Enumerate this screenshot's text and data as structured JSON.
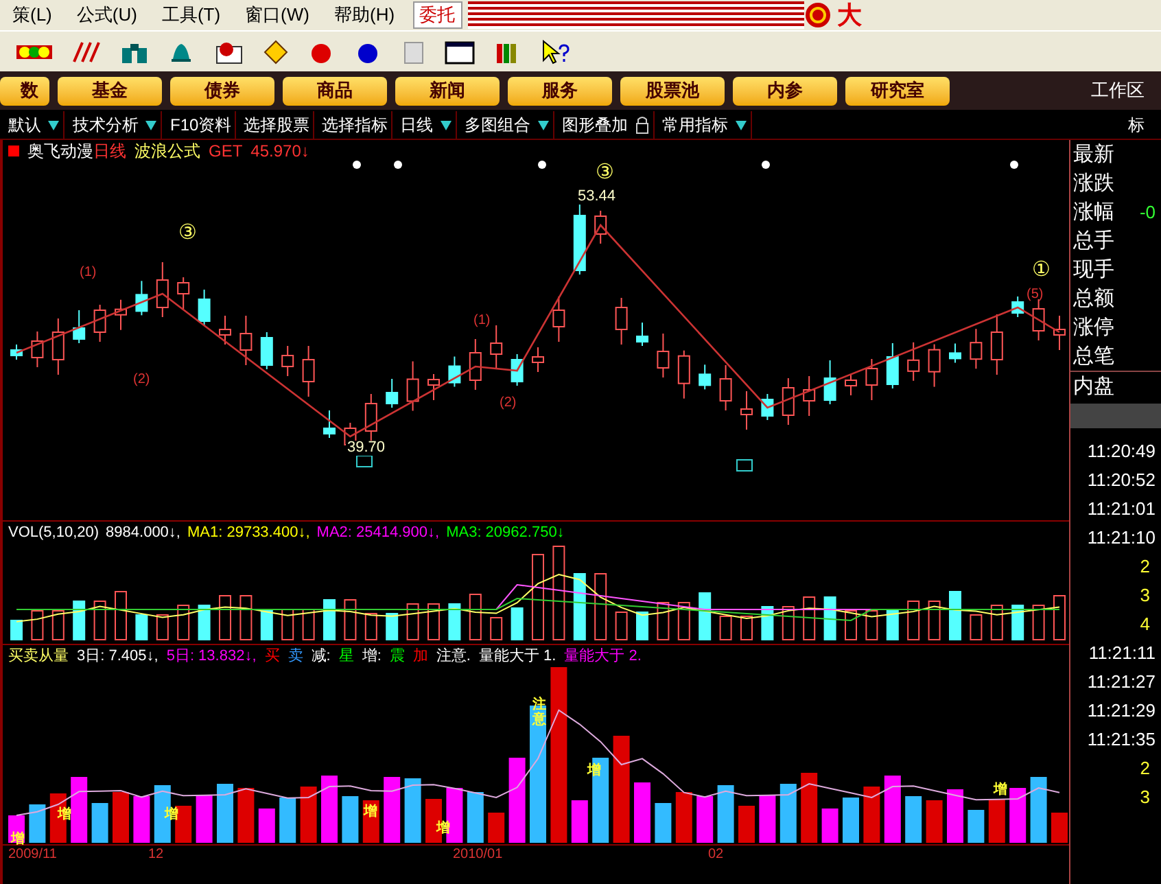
{
  "menu": {
    "items": [
      "策(L)",
      "公式(U)",
      "工具(T)",
      "窗口(W)",
      "帮助(H)"
    ],
    "trade_button": "委托",
    "corner_text": "大"
  },
  "nav_buttons": [
    "数",
    "基金",
    "债券",
    "商品",
    "新闻",
    "服务",
    "股票池",
    "内参",
    "研究室"
  ],
  "workspace_label": "工作区",
  "tabs": [
    {
      "label": "默认",
      "has_menu": true,
      "lock": false
    },
    {
      "label": "技术分析",
      "has_menu": true,
      "lock": false
    },
    {
      "label": "F10资料",
      "has_menu": false,
      "lock": false
    },
    {
      "label": "选择股票",
      "has_menu": false,
      "lock": false
    },
    {
      "label": "选择指标",
      "has_menu": false,
      "lock": false
    },
    {
      "label": "日线",
      "has_menu": true,
      "lock": false
    },
    {
      "label": "多图组合",
      "has_menu": true,
      "lock": false
    },
    {
      "label": "图形叠加",
      "has_menu": false,
      "lock": true
    },
    {
      "label": "常用指标",
      "has_menu": true,
      "lock": false
    }
  ],
  "tab_right": "标",
  "price_chart": {
    "stock": "奥飞动漫",
    "period": "日线",
    "formula": "波浪公式",
    "tag": "GET",
    "value": "45.970↓",
    "wave_labels": [
      "③",
      "③",
      "①"
    ],
    "price_labels": [
      "53.44",
      "39.70"
    ],
    "point_labels": [
      "(1)",
      "(2)",
      "(1)",
      "(2)",
      "(5)"
    ]
  },
  "volume_chart": {
    "name": "VOL(5,10,20)",
    "value": "8984.000↓,",
    "ma": [
      {
        "text": "MA1: 29733.400↓,",
        "color": "#ffff00"
      },
      {
        "text": "MA2: 25414.900↓,",
        "color": "#ff00ff"
      },
      {
        "text": "MA3: 20962.750↓",
        "color": "#00ff00"
      }
    ]
  },
  "indicator": {
    "name": "买卖从量",
    "legend": [
      {
        "text": "3日: 7.405↓,",
        "color": "#ffffff"
      },
      {
        "text": "5日: 13.832↓,",
        "color": "#ff00ff"
      },
      {
        "text": "买",
        "color": "#ff0000"
      },
      {
        "text": "卖",
        "color": "#3399ff"
      },
      {
        "text": "减:",
        "color": "#ffffff"
      },
      {
        "text": "星",
        "color": "#00ff00"
      },
      {
        "text": "增:",
        "color": "#ffffff"
      },
      {
        "text": "震",
        "color": "#00ff00"
      },
      {
        "text": "加",
        "color": "#ff0000"
      },
      {
        "text": "注意.",
        "color": "#ffffff"
      },
      {
        "text": "量能大于 1.",
        "color": "#ffffff"
      },
      {
        "text": "量能大于 2.",
        "color": "#ff00ff"
      }
    ],
    "bar_labels": [
      "增",
      "增",
      "增",
      "增",
      "增",
      "注意",
      "增",
      "增"
    ]
  },
  "date_axis": [
    "2009/11",
    "12",
    "2010/01",
    "02"
  ],
  "quote_panel": {
    "items": [
      {
        "label": "最新"
      },
      {
        "label": "涨跌"
      },
      {
        "label": "涨幅",
        "value": "-0"
      },
      {
        "label": "总手"
      },
      {
        "label": "现手"
      },
      {
        "label": "总额"
      },
      {
        "label": "涨停"
      },
      {
        "label": "总笔"
      },
      {
        "label": "内盘"
      }
    ],
    "ticks": [
      {
        "kind": "time",
        "text": "11:20:49"
      },
      {
        "kind": "time",
        "text": "11:20:52"
      },
      {
        "kind": "time",
        "text": "11:21:01"
      },
      {
        "kind": "time",
        "text": "11:21:10"
      },
      {
        "kind": "count",
        "text": "2"
      },
      {
        "kind": "count",
        "text": "3"
      },
      {
        "kind": "count",
        "text": "4"
      },
      {
        "kind": "time",
        "text": "11:21:11"
      },
      {
        "kind": "time",
        "text": "11:21:27"
      },
      {
        "kind": "time",
        "text": "11:21:29"
      },
      {
        "kind": "time",
        "text": "11:21:35"
      },
      {
        "kind": "count",
        "text": "2"
      },
      {
        "kind": "count",
        "text": "3"
      }
    ]
  }
}
